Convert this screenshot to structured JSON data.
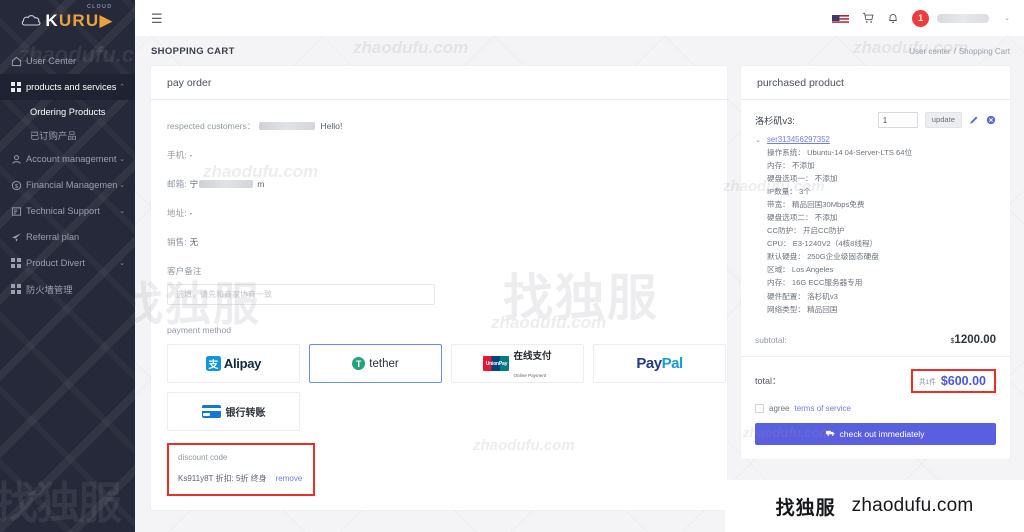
{
  "brand": {
    "logo_text_1": "K",
    "logo_text_2": "URU",
    "logo_arrow": "▶",
    "logo_sup": "CLOUD"
  },
  "sidebar": {
    "items": [
      {
        "label": "User Center",
        "icon": "home-icon",
        "chevron": "",
        "active": false
      },
      {
        "label": "products and services",
        "icon": "grid-icon",
        "chevron": "⌃",
        "active": true
      },
      {
        "label": "Account management",
        "icon": "user-icon",
        "chevron": "⌄",
        "active": false
      },
      {
        "label": "Financial Management",
        "icon": "dollar-icon",
        "chevron": "⌄",
        "active": false
      },
      {
        "label": "Technical Support",
        "icon": "ticket-icon",
        "chevron": "⌄",
        "active": false
      },
      {
        "label": "Referral plan",
        "icon": "send-icon",
        "chevron": "",
        "active": false
      },
      {
        "label": "Product Divert",
        "icon": "grid-icon",
        "chevron": "⌄",
        "active": false
      },
      {
        "label": "防火墙管理",
        "icon": "grid-icon",
        "chevron": "",
        "active": false
      }
    ],
    "sub_items": [
      {
        "label": "Ordering Products",
        "current": true
      },
      {
        "label": "已订购产品",
        "current": false
      }
    ],
    "watermark_cjk": "找独服"
  },
  "topbar": {
    "hamburger": "☰",
    "flag": "us-flag-icon",
    "cart_icon": "cart-icon",
    "bell_icon": "bell-icon",
    "badge_count": "1",
    "user_caret": "⌄"
  },
  "pagehead": {
    "title": "SHOPPING CART",
    "breadcrumb_root": "User center",
    "breadcrumb_sep": "/",
    "breadcrumb_current": "Shopping Cart"
  },
  "left_card": {
    "header": "pay order",
    "fields": [
      {
        "label": "respected customers：",
        "redacted": true,
        "value": "Hello!"
      },
      {
        "label": "手机:",
        "redacted": false,
        "value": "-"
      },
      {
        "label": "邮箱:",
        "redacted": true,
        "value": ""
      },
      {
        "label": "地址:",
        "redacted": false,
        "value": "-"
      },
      {
        "label": "销售:",
        "redacted": false,
        "value": "无"
      }
    ],
    "email_prefix": "宁",
    "email_suffix": "m",
    "note_label": "客户备注",
    "note_value": "",
    "note_placeholder": "选填，请先和商家协商一致",
    "payment_label": "payment method",
    "payment_methods": [
      {
        "name": "Alipay",
        "icon": "alipay-icon",
        "label": "Alipay",
        "selected": false
      },
      {
        "name": "tether",
        "icon": "tether-icon",
        "label": "tether",
        "selected": true
      },
      {
        "name": "UnionPay",
        "icon": "unionpay-icon",
        "label": "在线支付",
        "sub": "Online Payment",
        "selected": false
      },
      {
        "name": "PayPal",
        "icon": "paypal-icon",
        "label_a": "Pay",
        "label_b": "Pal",
        "selected": false
      },
      {
        "name": "BankTransfer",
        "icon": "bank-card-icon",
        "label": "银行转账",
        "selected": false
      }
    ],
    "discount": {
      "title": "discount code",
      "code_line": "Ks911y8T 折扣: 5折 终身",
      "remove_label": "remove"
    }
  },
  "right_card": {
    "header": "purchased product",
    "product_name": "洛杉矶v3:",
    "quantity": "1",
    "update_label": "update",
    "edit_icon": "pencil-icon",
    "delete_icon": "delete-circle-icon",
    "caret": "⌄",
    "server_id": "ser313456297352",
    "specs": [
      "操作系统： Ubuntu-14 04-Server-LTS 64位",
      "内存： 不添加",
      "硬盘选项一： 不添加",
      "IP数量： 3个",
      "带宽： 精品回国30Mbps免费",
      "硬盘选项二： 不添加",
      "CC防护： 开启CC防护",
      "CPU： E3-1240V2（4核8线程）",
      "默认硬盘： 250G企业级固态硬盘",
      "区域： Los Angeles",
      "内存： 16G ECC服务器专用",
      "硬件配置： 洛杉矶v3",
      "网络类型： 精品回国"
    ],
    "subtotal_label": "subtotal:",
    "subtotal_currency": "$",
    "subtotal_amount": "1200.00",
    "total_label": "total：",
    "total_count": "共1件",
    "total_amount": "$600.00",
    "agree_text": "agree",
    "terms_link": "terms of service",
    "checkout_icon": "truck-icon",
    "checkout_label": "check out immediately"
  },
  "watermarks": {
    "domain": "zhaodufu.com",
    "cjk": "找独服"
  },
  "footer": {
    "cjk": "找独服",
    "domain": "zhaodufu.com"
  },
  "colors": {
    "sidebar_bg": "#262939",
    "accent_blue": "#5a5fe0",
    "link_blue": "#6f7ee8",
    "highlight_red": "#e8302a",
    "badge_red": "#f13c3c"
  }
}
